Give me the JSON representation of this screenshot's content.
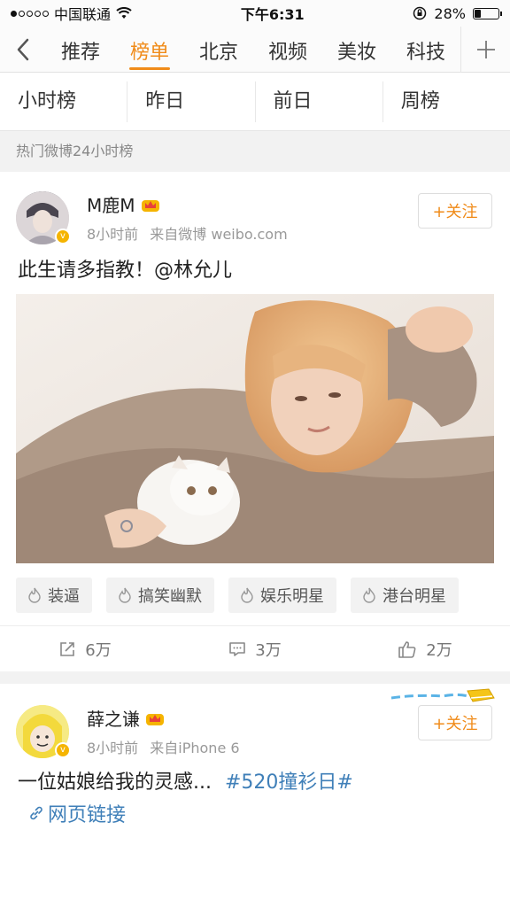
{
  "status_bar": {
    "carrier": "中国联通",
    "time": "下午6:31",
    "battery": "28%",
    "battery_level": 0.28
  },
  "nav": {
    "tabs": [
      "推荐",
      "榜单",
      "北京",
      "视频",
      "美妆",
      "科技"
    ],
    "active_tab": "榜单"
  },
  "subtabs": [
    "小时榜",
    "昨日",
    "前日",
    "周榜"
  ],
  "section_label": "热门微博24小时榜",
  "posts": [
    {
      "username": "M鹿M",
      "time": "8小时前",
      "source": "来自微博 weibo.com",
      "follow_label": "+关注",
      "text": "此生请多指教！@林允儿",
      "topics": [
        "装逼",
        "搞笑幽默",
        "娱乐明星",
        "港台明星"
      ],
      "reposts": "6万",
      "comments": "3万",
      "likes": "2万"
    },
    {
      "username": "薛之谦",
      "time": "8小时前",
      "source": "来自iPhone 6",
      "follow_label": "+关注",
      "text": "一位姑娘给我的灵感...",
      "hashtag": "#520撞衫日#",
      "link_label": "网页链接"
    }
  ],
  "colors": {
    "accent": "#f08b19",
    "link": "#3f7fb8",
    "verified_badge": "#f5b400"
  }
}
